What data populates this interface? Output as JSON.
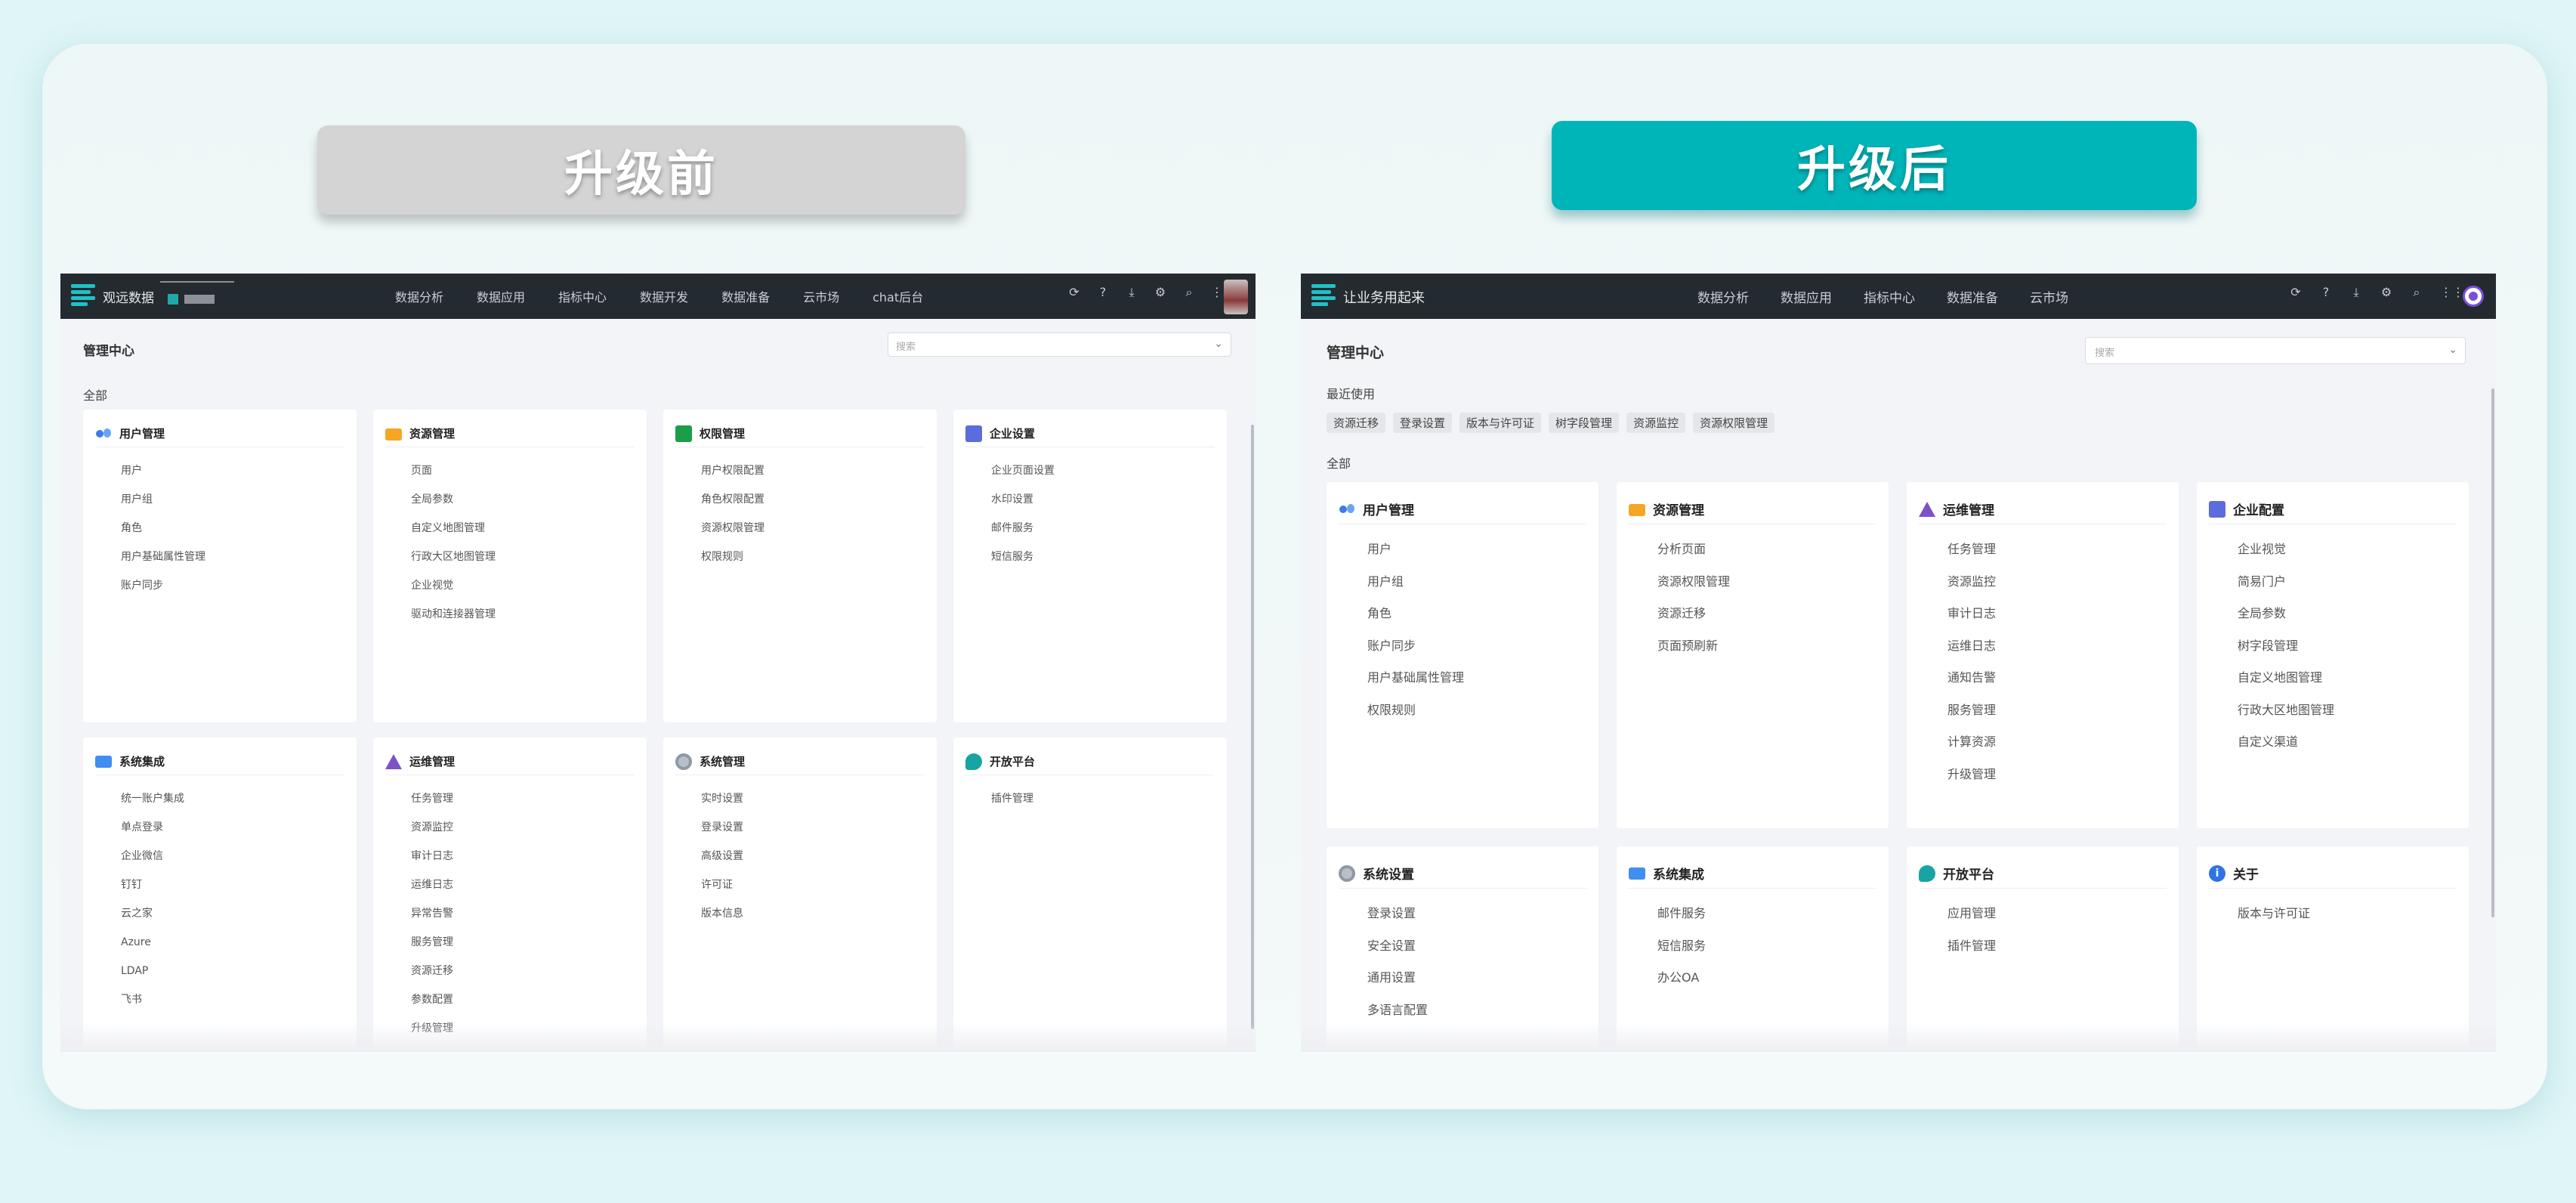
{
  "labels": {
    "before": "升级前",
    "after": "升级后"
  },
  "before": {
    "brand": "观远数据",
    "nav": [
      "数据分析",
      "数据应用",
      "指标中心",
      "数据开发",
      "数据准备",
      "云市场",
      "chat后台"
    ],
    "title": "管理中心",
    "search_placeholder": "搜索",
    "all_label": "全部",
    "cards": [
      {
        "title": "用户管理",
        "icon": "users-icon",
        "items": [
          "用户",
          "用户组",
          "角色",
          "用户基础属性管理",
          "账户同步"
        ]
      },
      {
        "title": "资源管理",
        "icon": "folder-icon",
        "items": [
          "页面",
          "全局参数",
          "自定义地图管理",
          "行政大区地图管理",
          "企业视觉",
          "驱动和连接器管理"
        ]
      },
      {
        "title": "权限管理",
        "icon": "shield-icon",
        "items": [
          "用户权限配置",
          "角色权限配置",
          "资源权限管理",
          "权限规则"
        ]
      },
      {
        "title": "企业设置",
        "icon": "building-icon",
        "items": [
          "企业页面设置",
          "水印设置",
          "邮件服务",
          "短信服务"
        ]
      },
      {
        "title": "系统集成",
        "icon": "system-icon",
        "items": [
          "统一账户集成",
          "单点登录",
          "企业微信",
          "钉钉",
          "云之家",
          "Azure",
          "LDAP",
          "飞书"
        ]
      },
      {
        "title": "运维管理",
        "icon": "ops-icon",
        "items": [
          "任务管理",
          "资源监控",
          "审计日志",
          "运维日志",
          "异常告警",
          "服务管理",
          "资源迁移",
          "参数配置",
          "升级管理"
        ]
      },
      {
        "title": "系统管理",
        "icon": "gear-icon",
        "items": [
          "实时设置",
          "登录设置",
          "高级设置",
          "许可证",
          "版本信息"
        ]
      },
      {
        "title": "开放平台",
        "icon": "open-icon",
        "items": [
          "插件管理"
        ]
      }
    ]
  },
  "after": {
    "brand": "让业务用起来",
    "nav": [
      "数据分析",
      "数据应用",
      "指标中心",
      "数据准备",
      "云市场"
    ],
    "title": "管理中心",
    "search_placeholder": "搜索",
    "recent_label": "最近使用",
    "recent": [
      "资源迁移",
      "登录设置",
      "版本与许可证",
      "树字段管理",
      "资源监控",
      "资源权限管理"
    ],
    "all_label": "全部",
    "cards": [
      {
        "title": "用户管理",
        "icon": "users-icon",
        "items": [
          "用户",
          "用户组",
          "角色",
          "账户同步",
          "用户基础属性管理",
          "权限规则"
        ]
      },
      {
        "title": "资源管理",
        "icon": "folder-icon",
        "items": [
          "分析页面",
          "资源权限管理",
          "资源迁移",
          "页面预刷新"
        ]
      },
      {
        "title": "运维管理",
        "icon": "ops-icon",
        "items": [
          "任务管理",
          "资源监控",
          "审计日志",
          "运维日志",
          "通知告警",
          "服务管理",
          "计算资源",
          "升级管理"
        ]
      },
      {
        "title": "企业配置",
        "icon": "building-icon",
        "items": [
          "企业视觉",
          "简易门户",
          "全局参数",
          "树字段管理",
          "自定义地图管理",
          "行政大区地图管理",
          "自定义渠道"
        ]
      },
      {
        "title": "系统设置",
        "icon": "gear-icon",
        "items": [
          "登录设置",
          "安全设置",
          "通用设置",
          "多语言配置"
        ]
      },
      {
        "title": "系统集成",
        "icon": "system-icon",
        "items": [
          "邮件服务",
          "短信服务",
          "办公OA"
        ]
      },
      {
        "title": "开放平台",
        "icon": "open-icon",
        "items": [
          "应用管理",
          "插件管理"
        ]
      },
      {
        "title": "关于",
        "icon": "info-icon",
        "items": [
          "版本与许可证"
        ]
      }
    ]
  }
}
